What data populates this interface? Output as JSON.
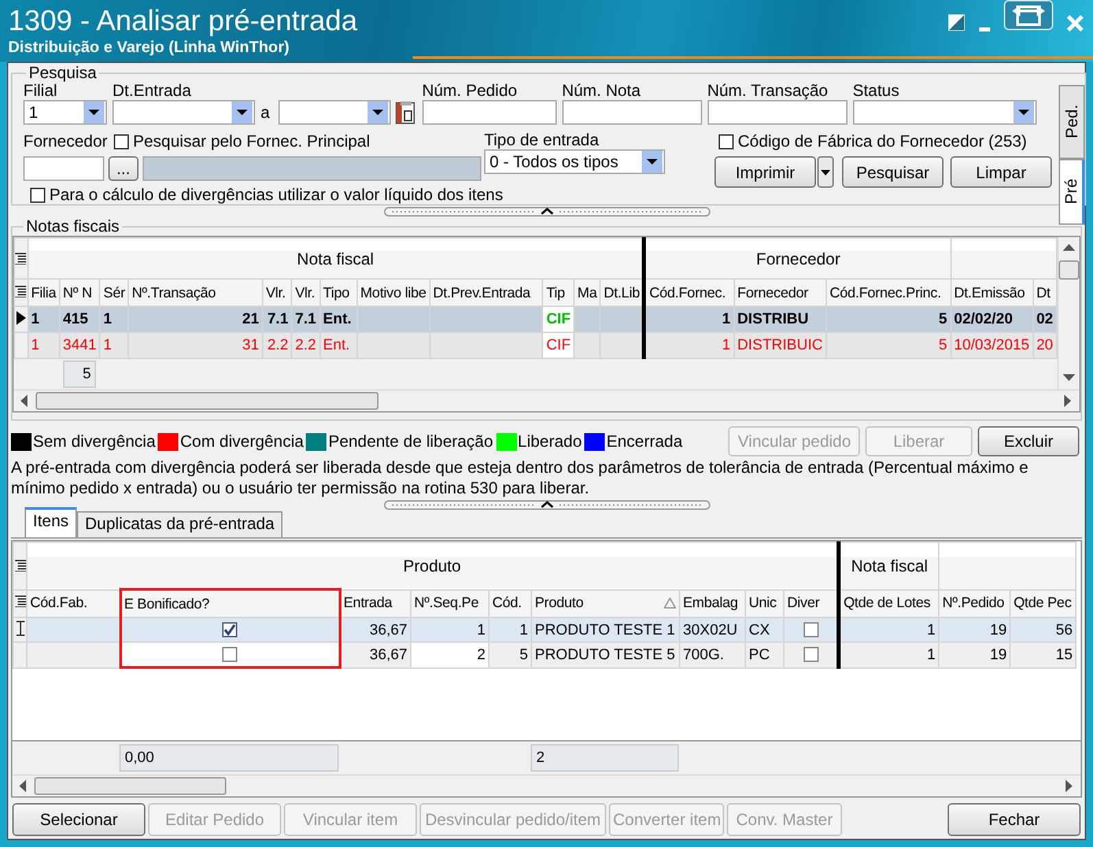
{
  "window": {
    "title": "1309 - Analisar pré-entrada",
    "subtitle": "Distribuição e Varejo (Linha WinThor)"
  },
  "search": {
    "legend": "Pesquisa",
    "filial": {
      "label": "Filial",
      "value": "1"
    },
    "dt_entrada": {
      "label": "Dt.Entrada",
      "separator": "a"
    },
    "num_pedido": {
      "label": "Núm. Pedido"
    },
    "num_nota": {
      "label": "Núm. Nota"
    },
    "num_transacao": {
      "label": "Núm. Transação"
    },
    "status": {
      "label": "Status"
    },
    "fornecedor": {
      "label": "Fornecedor",
      "lookup_button": "..."
    },
    "fornec_principal": {
      "label": "Pesquisar pelo Fornec. Principal",
      "checked": false
    },
    "tipo_entrada": {
      "label": "Tipo de entrada",
      "value": "0 - Todos os tipos"
    },
    "codigo_fabrica": {
      "label": "Código de Fábrica do Fornecedor (253)",
      "checked": false
    },
    "valor_liquido": {
      "label": "Para o cálculo de divergências utilizar o valor líquido dos itens",
      "checked": false
    },
    "buttons": [
      {
        "label": "Imprimir",
        "kind": "split"
      },
      {
        "label": "Pesquisar",
        "kind": "plain"
      },
      {
        "label": "Limpar",
        "kind": "plain"
      }
    ],
    "side_tabs": [
      {
        "label": "Ped.",
        "selected": false
      },
      {
        "label": "Pré",
        "selected": true
      }
    ]
  },
  "notas": {
    "legend": "Notas fiscais",
    "groups": [
      {
        "label": "Nota fiscal"
      },
      {
        "label": "Fornecedor"
      }
    ],
    "columns": [
      "Filia",
      "Nº N",
      "Sér",
      "Nº.Transação",
      "Vlr.",
      "Vlr.",
      "Tipo",
      "Motivo libe",
      "Dt.Prev.Entrada",
      "Tip",
      "Ma",
      "Dt.Lib",
      "Cód.Fornec.",
      "Fornecedor",
      "Cód.Fornec.Princ.",
      "Dt.Emissão",
      "Dt"
    ],
    "rows": [
      {
        "selected": true,
        "color": "#000000",
        "cells": [
          "1",
          "415",
          "1",
          "21",
          "7.1",
          "7.1",
          "Ent.",
          "",
          "",
          {
            "text": "CIF",
            "color": "#00c000"
          },
          "",
          "",
          "1",
          "DISTRIBU",
          "5",
          "02/02/20",
          "02"
        ]
      },
      {
        "selected": false,
        "color": "#ff0000",
        "cells": [
          "1",
          "3441",
          "1",
          "31",
          "2.2",
          "2.2",
          "Ent.",
          "",
          "",
          {
            "text": "CIF",
            "color": "#ff0000"
          },
          "",
          "",
          "1",
          "DISTRIBUIC",
          "5",
          "10/03/2015",
          "20"
        ]
      }
    ],
    "count": "5"
  },
  "legend": [
    {
      "label": "Sem divergência",
      "color": "#000000"
    },
    {
      "label": "Com divergência",
      "color": "#ff0000"
    },
    {
      "label": "Pendente de liberação",
      "color": "#008080"
    },
    {
      "label": "Liberado",
      "color": "#00ff00"
    },
    {
      "label": "Encerrada",
      "color": "#0000ff"
    }
  ],
  "actions": [
    {
      "label": "Vincular pedido",
      "disabled": true
    },
    {
      "label": "Liberar",
      "disabled": true
    },
    {
      "label": "Excluir",
      "disabled": false
    }
  ],
  "note": "A pré-entrada com divergência poderá ser liberada desde que esteja dentro dos parâmetros de tolerância de entrada (Percentual máximo e mínimo pedido x entrada) ou o usuário ter permissão na rotina 530 para liberar.",
  "item_tabs": [
    {
      "label": "Itens",
      "selected": true
    },
    {
      "label": "Duplicatas da pré-entrada",
      "selected": false
    }
  ],
  "itens": {
    "groups": [
      {
        "label": "Produto"
      },
      {
        "label": "Nota fiscal"
      }
    ],
    "columns": [
      {
        "label": "Cód.Fab.",
        "kind": "text"
      },
      {
        "label": "E Bonificado?",
        "kind": "check",
        "highlight": true
      },
      {
        "label": "Entrada",
        "kind": "number"
      },
      {
        "label": "Nº.Seq.Pe",
        "kind": "input"
      },
      {
        "label": "Cód.",
        "kind": "number"
      },
      {
        "label": "Produto",
        "kind": "text",
        "sorted": true
      },
      {
        "label": "Embalag",
        "kind": "text"
      },
      {
        "label": "Unic",
        "kind": "text"
      },
      {
        "label": "Diver",
        "kind": "check"
      },
      {
        "label": "Qtde de Lotes",
        "kind": "number"
      },
      {
        "label": "Nº.Pedido",
        "kind": "number"
      },
      {
        "label": "Qtde Pec",
        "kind": "number"
      }
    ],
    "rows": [
      {
        "selected": true,
        "cells": [
          "",
          true,
          "36,67",
          "1",
          "1",
          "PRODUTO TESTE 1",
          "30X02U",
          "CX",
          false,
          "1",
          "19",
          "56"
        ]
      },
      {
        "selected": false,
        "cells": [
          "",
          false,
          "36,67",
          "2",
          "5",
          "PRODUTO TESTE 5",
          "700G.",
          "PC",
          false,
          "1",
          "19",
          "15"
        ]
      }
    ],
    "totals": [
      "0,00",
      "2"
    ]
  },
  "buttons": [
    {
      "label": "Selecionar",
      "disabled": false
    },
    {
      "label": "Editar Pedido",
      "disabled": true
    },
    {
      "label": "Vincular item",
      "disabled": true
    },
    {
      "label": "Desvincular pedido/item",
      "disabled": true
    },
    {
      "label": "Converter item",
      "disabled": true
    },
    {
      "label": "Conv. Master",
      "disabled": true
    },
    {
      "label": "Fechar",
      "disabled": false
    }
  ]
}
